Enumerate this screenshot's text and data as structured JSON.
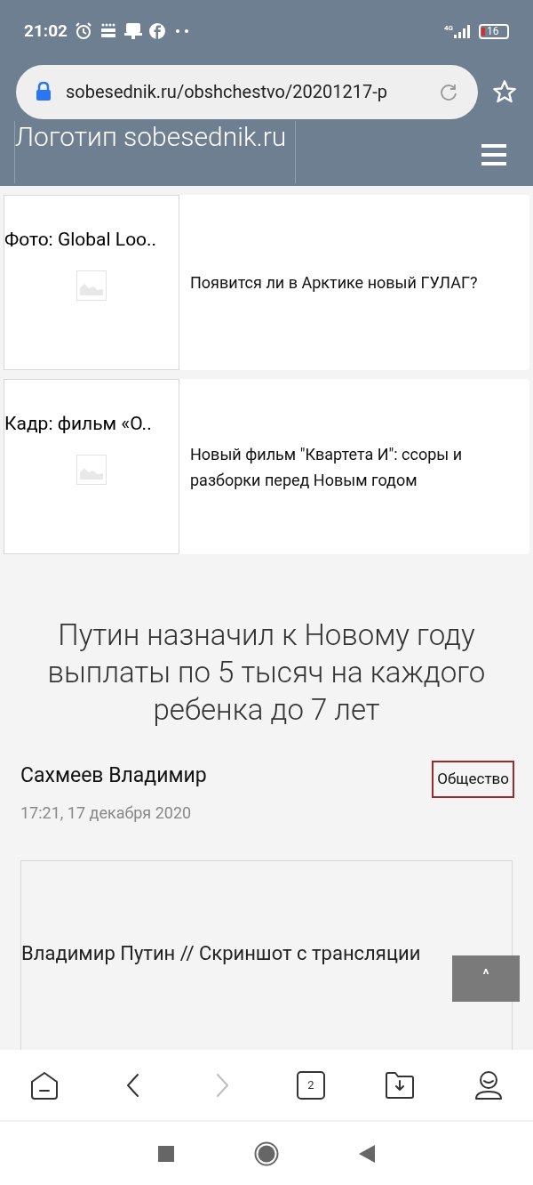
{
  "status_bar": {
    "time": "21:02",
    "network": "4G",
    "battery": "16"
  },
  "address_bar": {
    "url": "sobesednik.ru/obshchestvo/20201217-p"
  },
  "header": {
    "logo_alt": "Логотип sobesednik.ru"
  },
  "related": [
    {
      "image_alt": "Фото: Global Loo..",
      "title": "Появится ли в Арктике новый ГУЛАГ?"
    },
    {
      "image_alt": "Кадр: фильм «О..",
      "title": "Новый фильм \"Квартета И\": ссоры и разборки перед Новым годом"
    }
  ],
  "article": {
    "title": "Путин назначил к Новому году выплаты по 5 тысяч на каждого ребенка до 7 лет",
    "author": "Сахмеев Владимир",
    "category": "Общество",
    "date": "17:21, 17 декабря 2020",
    "image_caption": "Владимир Путин // Скриншот с трансляции"
  },
  "scroll_top": {
    "label": "^"
  },
  "toolbar": [
    {
      "kind": "home",
      "disabled": false
    },
    {
      "kind": "back",
      "disabled": false
    },
    {
      "kind": "forward",
      "disabled": true
    },
    {
      "kind": "tabs",
      "count": "2",
      "disabled": false
    },
    {
      "kind": "downloads",
      "disabled": false
    },
    {
      "kind": "profile",
      "disabled": false
    }
  ]
}
